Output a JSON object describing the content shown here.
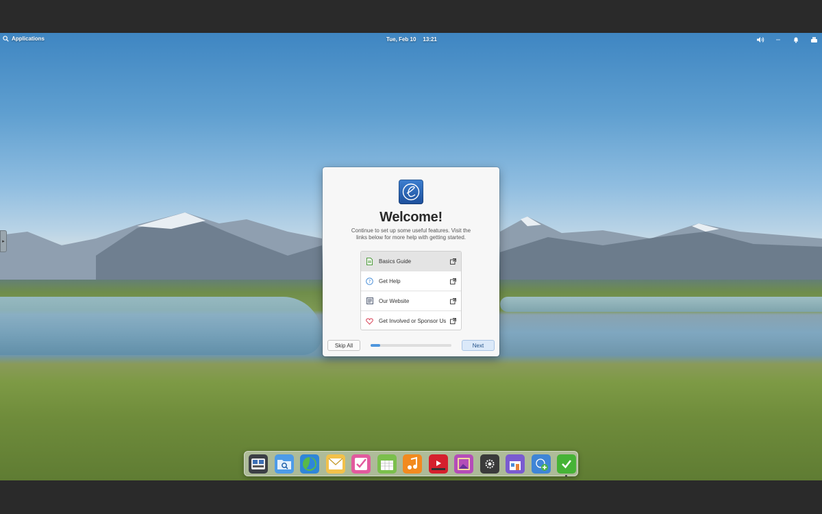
{
  "panel": {
    "applications_label": "Applications",
    "date": "Tue, Feb 10",
    "time": "13:21"
  },
  "dialog": {
    "title": "Welcome!",
    "subtitle": "Continue to set up some useful features. Visit the links below for more help with getting started.",
    "links": [
      {
        "label": "Basics Guide",
        "icon": "document-icon"
      },
      {
        "label": "Get Help",
        "icon": "help-icon"
      },
      {
        "label": "Our Website",
        "icon": "website-icon"
      },
      {
        "label": "Get Involved or Sponsor Us",
        "icon": "heart-icon"
      }
    ],
    "skip_label": "Skip All",
    "next_label": "Next",
    "progress": 0.12
  },
  "dock": {
    "items": [
      {
        "name": "multitasking-view-icon",
        "color": "#3c3f45"
      },
      {
        "name": "files-icon",
        "color": "#4d9be8"
      },
      {
        "name": "web-browser-icon",
        "color": "#2f86d8"
      },
      {
        "name": "mail-icon",
        "color": "#f2c14a"
      },
      {
        "name": "tasks-icon",
        "color": "#e25a9e"
      },
      {
        "name": "calendar-icon",
        "color": "#7bbf4c"
      },
      {
        "name": "music-icon",
        "color": "#f28a1f"
      },
      {
        "name": "videos-icon",
        "color": "#d5202d"
      },
      {
        "name": "photos-icon",
        "color": "#b44db8"
      },
      {
        "name": "system-settings-icon",
        "color": "#3a3a3a"
      },
      {
        "name": "appcenter-icon",
        "color": "#7a5bd0"
      },
      {
        "name": "installer-icon",
        "color": "#3f85d6"
      },
      {
        "name": "checkmark-app-icon",
        "color": "#46b336"
      }
    ]
  }
}
